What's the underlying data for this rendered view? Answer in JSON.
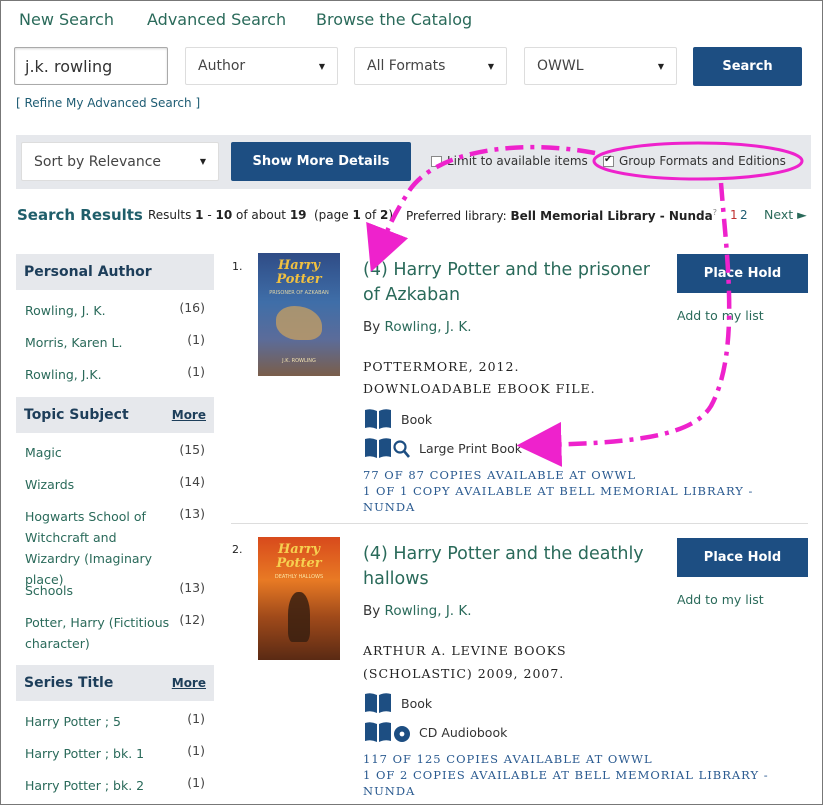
{
  "nav": {
    "new_search": "New Search",
    "advanced_search": "Advanced Search",
    "browse_catalog": "Browse the Catalog"
  },
  "search": {
    "query": "j.k. rowling",
    "field": "Author",
    "format": "All Formats",
    "library": "OWWL",
    "button": "Search",
    "refine": "[ Refine My Advanced Search ]"
  },
  "options": {
    "sort": "Sort by Relevance",
    "show_more": "Show More Details",
    "limit_label": "Limit to available items",
    "group_label": "Group Formats and Editions"
  },
  "results_header": {
    "title": "Search Results",
    "results_prefix": "Results ",
    "range_from": "1",
    "range_sep": " - ",
    "range_to": "10",
    "of_about": " of about ",
    "total": "19",
    "page_prefix": "(page ",
    "page_num": "1",
    "page_of": " of ",
    "page_total": "2",
    "page_suffix": ")",
    "preferred_label": "Preferred library: ",
    "preferred_lib": "Bell Memorial Library - Nunda",
    "help_sup": "?",
    "page1": "1",
    "page2": "2",
    "next": "Next ►"
  },
  "facets": {
    "author": {
      "title": "Personal Author",
      "items": [
        {
          "label": "Rowling, J. K.",
          "count": "(16)"
        },
        {
          "label": "Morris, Karen L.",
          "count": "(1)"
        },
        {
          "label": "Rowling, J.K.",
          "count": "(1)"
        }
      ]
    },
    "topic": {
      "title": "Topic Subject",
      "more": "More",
      "items": [
        {
          "label": "Magic",
          "count": "(15)"
        },
        {
          "label": "Wizards",
          "count": "(14)"
        },
        {
          "label": "Hogwarts School of Witchcraft and Wizardry (Imaginary place)",
          "count": "(13)"
        },
        {
          "label": "Schools",
          "count": "(13)"
        },
        {
          "label": "Potter, Harry (Fictitious character)",
          "count": "(12)"
        }
      ]
    },
    "series": {
      "title": "Series Title",
      "more": "More",
      "items": [
        {
          "label": "Harry Potter ; 5",
          "count": "(1)"
        },
        {
          "label": "Harry Potter ; bk. 1",
          "count": "(1)"
        },
        {
          "label": "Harry Potter ; bk. 2",
          "count": "(1)"
        }
      ]
    }
  },
  "results": [
    {
      "num": "1.",
      "title": "(4) Harry Potter and the prisoner of Azkaban",
      "by": "By ",
      "author": "Rowling, J. K.",
      "pub1": "POTTERMORE, 2012.",
      "pub2": "DOWNLOADABLE EBOOK FILE.",
      "format1": "Book",
      "format2": "Large Print Book",
      "copies1": "77 OF 87 COPIES AVAILABLE AT OWWL",
      "copies2": "1 OF 1 COPY AVAILABLE AT BELL MEMORIAL LIBRARY - NUNDA",
      "hold": "Place Hold",
      "addlist": "Add to my list",
      "cover_title": "Harry Potter",
      "cover_sub": "PRISONER OF AZKABAN",
      "cover_author": "J.K. ROWLING"
    },
    {
      "num": "2.",
      "title": "(4) Harry Potter and the deathly hallows",
      "by": "By ",
      "author": "Rowling, J. K.",
      "pub1": "ARTHUR A. LEVINE BOOKS",
      "pub2": "(SCHOLASTIC) 2009, 2007.",
      "format1": "Book",
      "format2": "CD Audiobook",
      "copies1": "117 OF 125 COPIES AVAILABLE AT OWWL",
      "copies2": "1 OF 2 COPIES AVAILABLE AT BELL MEMORIAL LIBRARY - NUNDA",
      "hold": "Place Hold",
      "addlist": "Add to my list",
      "cover_title": "Harry Potter",
      "cover_sub": "DEATHLY HALLOWS"
    }
  ],
  "colors": {
    "accent": "#1d4e82",
    "link": "#2a6a5a",
    "annotation": "#ee22cc"
  }
}
